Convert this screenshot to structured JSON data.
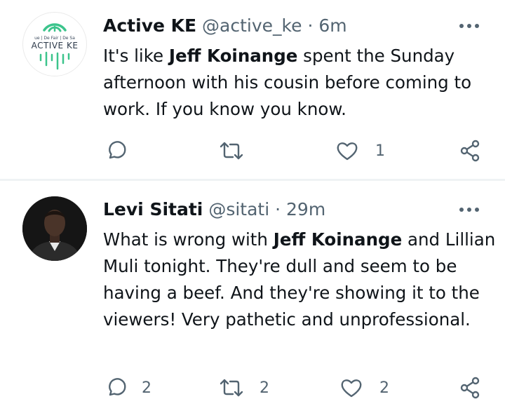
{
  "tweets": [
    {
      "name": "Active KE",
      "handle": "@active_ke",
      "separator": "·",
      "time": "6m",
      "avatar_text": {
        "top": "ue | De Fair | De Sa",
        "main": "ACTIVE KE"
      },
      "body": [
        {
          "text": "It's like ",
          "bold": false
        },
        {
          "text": "Jeff Koinange",
          "bold": true
        },
        {
          "text": " spent the Sunday afternoon with his cousin before coming to work. If you know you know.",
          "bold": false
        }
      ],
      "actions": {
        "reply": "",
        "retweet": "",
        "like": "1"
      }
    },
    {
      "name": "Levi Sitati",
      "handle": "@sitati",
      "separator": "·",
      "time": "29m",
      "body": [
        {
          "text": "What is wrong with ",
          "bold": false
        },
        {
          "text": "Jeff Koinange",
          "bold": true
        },
        {
          "text": " and Lillian Muli tonight. They're dull and seem to be having a beef. And they're showing it to the viewers! Very pathetic and unprofessional.",
          "bold": false
        }
      ],
      "actions": {
        "reply": "2",
        "retweet": "2",
        "like": "2"
      }
    }
  ],
  "colors": {
    "text": "#0f1419",
    "secondary": "#536471",
    "divider": "#eff3f4",
    "brand_green": "#3cc48c"
  },
  "icons": [
    "more-icon",
    "reply-icon",
    "retweet-icon",
    "like-icon",
    "share-icon"
  ]
}
